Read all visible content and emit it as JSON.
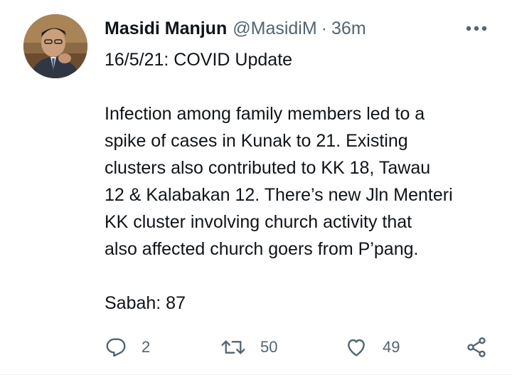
{
  "tweet": {
    "author_name": "Masidi Manjun",
    "handle": "@MasidiM",
    "separator": "·",
    "time": "36m",
    "body_lines": [
      "16/5/21: COVID Update",
      "",
      "Infection among family members led to a",
      "spike of cases in Kunak to 21. Existing",
      "clusters also contributed to KK 18, Tawau",
      "12 & Kalabakan 12. There’s new Jln Menteri",
      "KK cluster involving church activity that",
      "also affected church goers from P’pang.",
      "",
      "Sabah: 87"
    ]
  },
  "actions": {
    "reply_count": "2",
    "retweet_count": "50",
    "like_count": "49"
  },
  "icons": {
    "more": "more-horizontal-icon",
    "reply": "reply-icon",
    "retweet": "retweet-icon",
    "like": "heart-icon",
    "share": "share-icon"
  },
  "colors": {
    "text": "#0f1419",
    "secondary": "#536471",
    "divider": "#eff3f4"
  }
}
